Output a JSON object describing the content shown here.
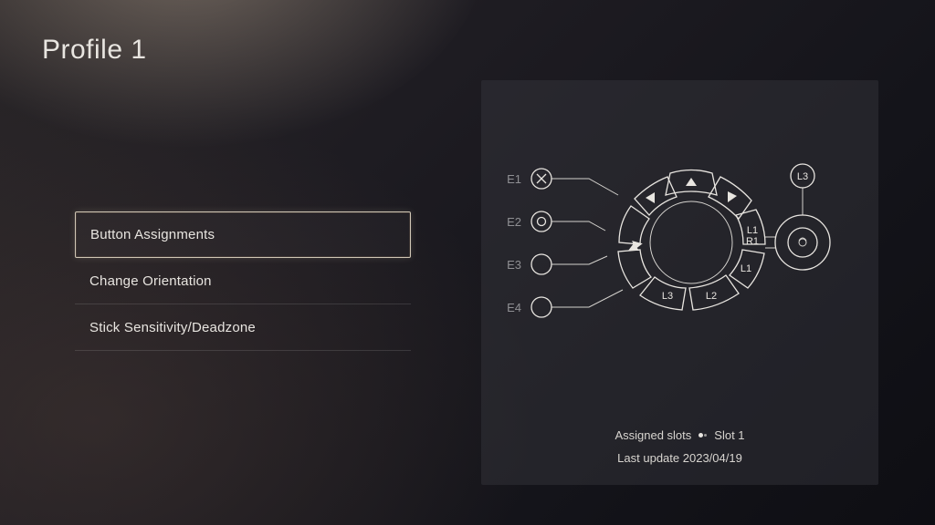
{
  "title": "Profile 1",
  "menu": {
    "items": [
      {
        "label": "Button Assignments",
        "selected": true
      },
      {
        "label": "Change Orientation",
        "selected": false
      },
      {
        "label": "Stick Sensitivity/Deadzone",
        "selected": false
      }
    ]
  },
  "controller": {
    "expansion": [
      {
        "label": "E1",
        "assignment": "cross"
      },
      {
        "label": "E2",
        "assignment": "circle"
      },
      {
        "label": "E3",
        "assignment": ""
      },
      {
        "label": "E4",
        "assignment": ""
      }
    ],
    "buttons_ring": [
      {
        "position": "top",
        "label": "up-arrow"
      },
      {
        "position": "top-right",
        "label": "right-arrow"
      },
      {
        "position": "right",
        "label": "L1 R1"
      },
      {
        "position": "bottom-right",
        "label": "L1"
      },
      {
        "position": "bottom",
        "label": "L2"
      },
      {
        "position": "bottom-left",
        "label": "L3"
      },
      {
        "position": "left",
        "label": "down-arrow"
      },
      {
        "position": "top-left",
        "label": "left-arrow"
      }
    ],
    "stick": {
      "label": "L3",
      "secondary_label": "L3"
    }
  },
  "footer": {
    "assigned_label": "Assigned slots",
    "slot": "Slot 1",
    "last_update_label": "Last update",
    "last_update_value": "2023/04/19"
  }
}
